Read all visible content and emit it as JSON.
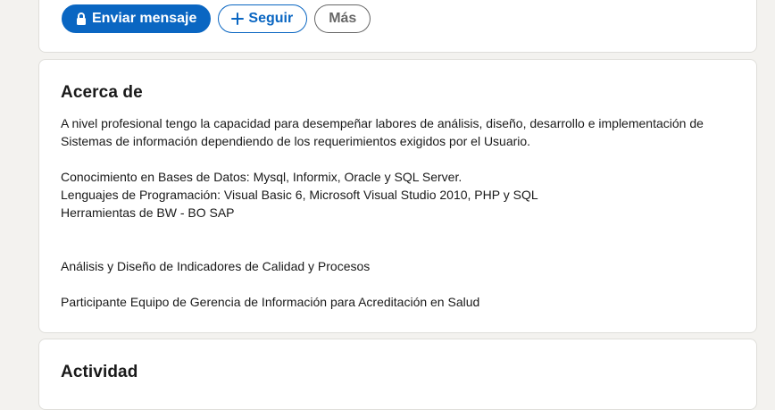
{
  "actions": {
    "message_label": "Enviar mensaje",
    "follow_label": "Seguir",
    "more_label": "Más"
  },
  "about": {
    "title": "Acerca de",
    "paragraph1_line1": "A nivel profesional tengo la capacidad para desempeñar labores de análisis, diseño, desarrollo e implementación de",
    "paragraph1_line2": "Sistemas de información dependiendo de los requerimientos exigidos por el Usuario.",
    "skill_db": "Conocimiento en Bases de Datos: Mysql, Informix, Oracle y SQL Server.",
    "skill_lang": "Lenguajes de Programación: Visual Basic 6, Microsoft Visual Studio 2010, PHP y SQL",
    "skill_tools": "Herramientas de BW - BO SAP",
    "indicators": "Análisis y Diseño de Indicadores de Calidad y Procesos",
    "team": "Participante Equipo de Gerencia de Información para Acreditación en Salud"
  },
  "activity": {
    "title": "Actividad"
  },
  "colors": {
    "primary": "#0a66c2",
    "background": "#f3f2ef",
    "card": "#ffffff"
  },
  "icons": {
    "message": "lock-icon",
    "follow": "plus-icon"
  }
}
